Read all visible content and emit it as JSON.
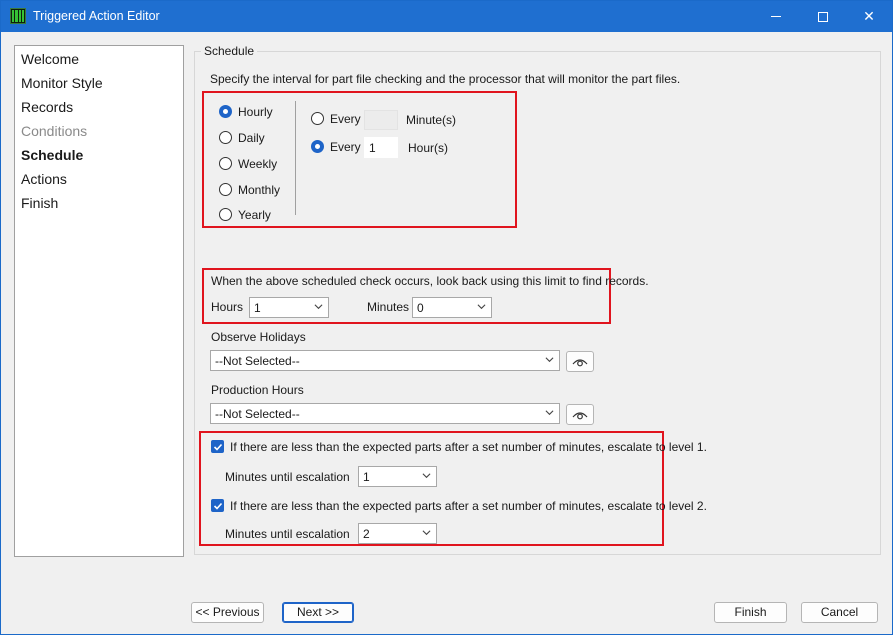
{
  "window": {
    "title": "Triggered Action Editor",
    "controls": {
      "minimize_icon": "minimize-icon",
      "maximize_icon": "maximize-icon",
      "close_icon": "close-icon",
      "close_glyph": "✕"
    }
  },
  "nav": {
    "items": [
      {
        "label": "Welcome",
        "state": "normal"
      },
      {
        "label": "Monitor Style",
        "state": "normal"
      },
      {
        "label": "Records",
        "state": "normal"
      },
      {
        "label": "Conditions",
        "state": "disabled"
      },
      {
        "label": "Schedule",
        "state": "active"
      },
      {
        "label": "Actions",
        "state": "normal"
      },
      {
        "label": "Finish",
        "state": "normal"
      }
    ]
  },
  "schedule": {
    "legend": "Schedule",
    "intro": "Specify the interval for part file checking and the processor that will monitor the part files.",
    "frequency": {
      "selected": "Hourly",
      "options": [
        "Hourly",
        "Daily",
        "Weekly",
        "Monthly",
        "Yearly"
      ]
    },
    "interval": {
      "every_label": "Every",
      "minutes_value": "",
      "minutes_unit": "Minute(s)",
      "hours_value": "1",
      "hours_unit": "Hour(s)",
      "selected": "hours"
    },
    "lookback": {
      "text": "When the above scheduled check occurs, look back using this limit to find records.",
      "hours_label": "Hours",
      "hours_value": "1",
      "minutes_label": "Minutes",
      "minutes_value": "0"
    },
    "observe_holidays": {
      "label": "Observe Holidays",
      "value": "--Not Selected--"
    },
    "production_hours": {
      "label": "Production Hours",
      "value": "--Not Selected--"
    },
    "escalation1": {
      "checked": true,
      "text": "If there are less than the expected parts after a set number of minutes, escalate to level 1.",
      "minutes_label": "Minutes until escalation",
      "minutes_value": "1"
    },
    "escalation2": {
      "checked": true,
      "text": "If there are less than the expected parts after a set number of minutes, escalate to level 2.",
      "minutes_label": "Minutes until escalation",
      "minutes_value": "2"
    }
  },
  "footer": {
    "previous": "<< Previous",
    "next": "Next >>",
    "finish": "Finish",
    "cancel": "Cancel"
  },
  "colors": {
    "titlebar": "#1f6fd0",
    "accent": "#1e64c8",
    "highlight_box": "#e0141e"
  }
}
